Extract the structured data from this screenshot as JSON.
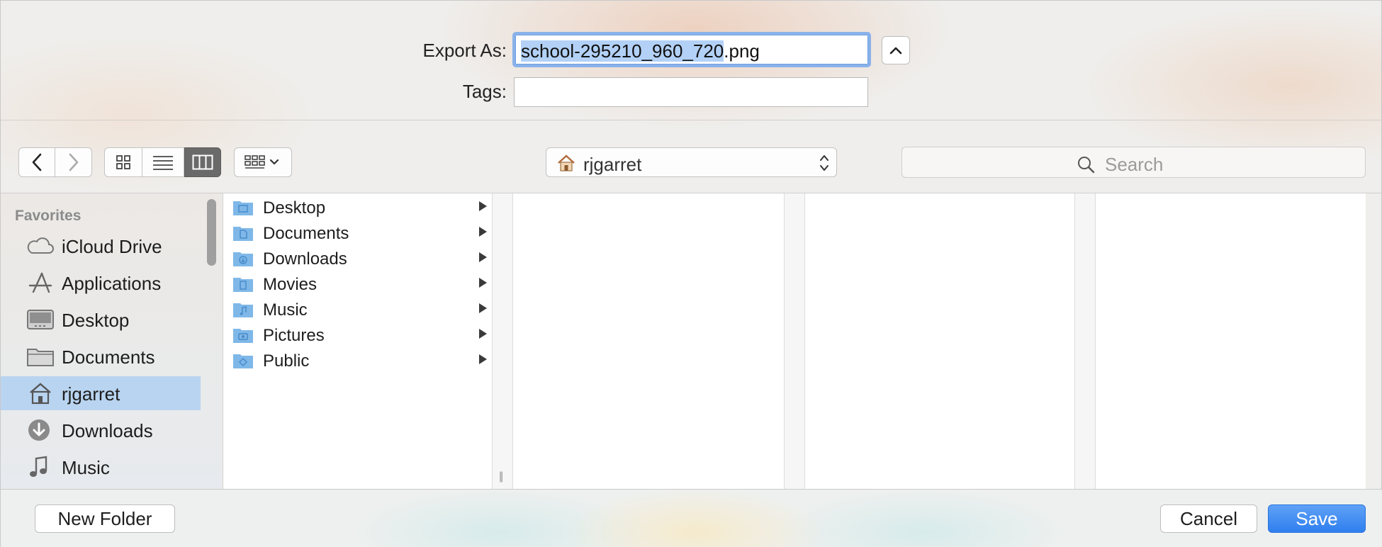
{
  "export": {
    "label": "Export As:",
    "filename_selected": "school-295210_960_720",
    "filename_ext": ".png",
    "tags_label": "Tags:",
    "tags_value": ""
  },
  "toolbar": {
    "location": "rjgarret",
    "search_placeholder": "Search"
  },
  "sidebar": {
    "heading": "Favorites",
    "items": [
      {
        "label": "iCloud Drive",
        "icon": "cloud-icon"
      },
      {
        "label": "Applications",
        "icon": "applications-icon"
      },
      {
        "label": "Desktop",
        "icon": "desktop-icon"
      },
      {
        "label": "Documents",
        "icon": "folder-icon"
      },
      {
        "label": "rjgarret",
        "icon": "home-icon",
        "selected": true
      },
      {
        "label": "Downloads",
        "icon": "download-icon"
      },
      {
        "label": "Music",
        "icon": "music-icon"
      }
    ]
  },
  "browser": {
    "column1": [
      {
        "label": "Desktop",
        "icon": "desktop-folder-icon"
      },
      {
        "label": "Documents",
        "icon": "documents-folder-icon"
      },
      {
        "label": "Downloads",
        "icon": "downloads-folder-icon"
      },
      {
        "label": "Movies",
        "icon": "movies-folder-icon"
      },
      {
        "label": "Music",
        "icon": "music-folder-icon"
      },
      {
        "label": "Pictures",
        "icon": "pictures-folder-icon"
      },
      {
        "label": "Public",
        "icon": "public-folder-icon"
      }
    ],
    "resize_grip": "||"
  },
  "buttons": {
    "new_folder": "New Folder",
    "cancel": "Cancel",
    "save": "Save"
  },
  "colors": {
    "accent": "#2f7fef",
    "selection": "#b3d1f7",
    "sidebar_selected": "#b9d4f0",
    "folder_blue": "#7fb8e8"
  }
}
